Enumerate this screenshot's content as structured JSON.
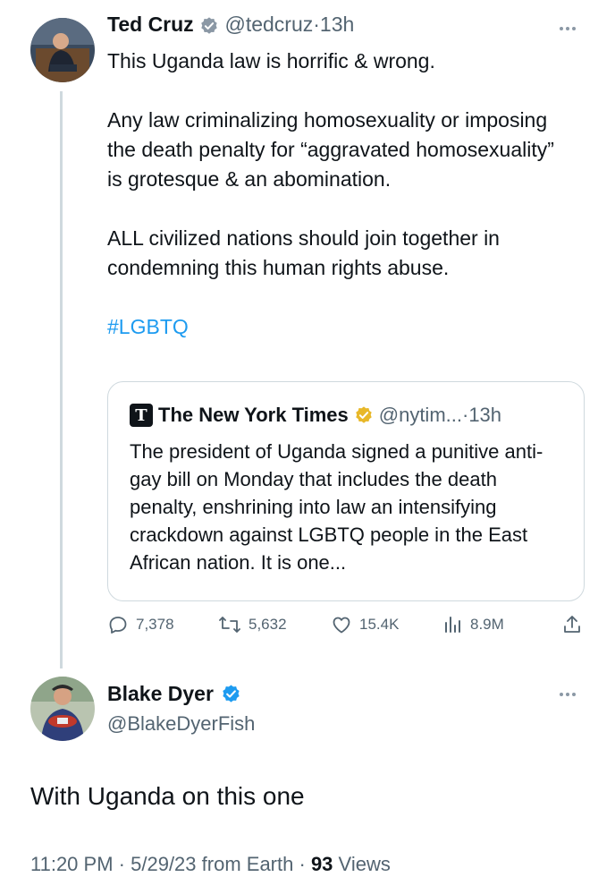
{
  "tweet": {
    "name": "Ted Cruz",
    "handle": "@tedcruz",
    "dot": "·",
    "time": "13h",
    "paragraphs": [
      "This Uganda law is horrific & wrong.",
      "Any law criminalizing homosexuality or imposing the death penalty for “aggravated homosexuality” is grotesque & an abomination.",
      "ALL civilized nations should join together in condemning this human rights abuse."
    ],
    "hashtag": "#LGBTQ",
    "quote": {
      "logo": "T",
      "name": "The New York Times",
      "handle": "@nytim...",
      "dot": "·",
      "time": "13h",
      "text": "The president of Uganda signed a punitive anti-gay bill on Monday that includes the death penalty, enshrining into law an intensifying crackdown against LGBTQ people in the East African nation. It is one..."
    },
    "actions": {
      "replies": "7,378",
      "retweets": "5,632",
      "likes": "15.4K",
      "views": "8.9M"
    }
  },
  "reply": {
    "name": "Blake Dyer",
    "handle": "@BlakeDyerFish",
    "text": "With Uganda on this one",
    "time": "11:20 PM",
    "date": "5/29/23",
    "source": "from Earth",
    "sep": "·",
    "views_count": "93",
    "views_label": "Views"
  },
  "colors": {
    "accent": "#1d9bf0",
    "gold_badge": "#e8b829",
    "muted": "#536471",
    "border": "#cfd9de"
  },
  "icons": [
    "verified-badge-icon",
    "more-icon",
    "reply-icon",
    "retweet-icon",
    "like-icon",
    "views-icon",
    "share-icon",
    "nyt-logo-icon"
  ]
}
